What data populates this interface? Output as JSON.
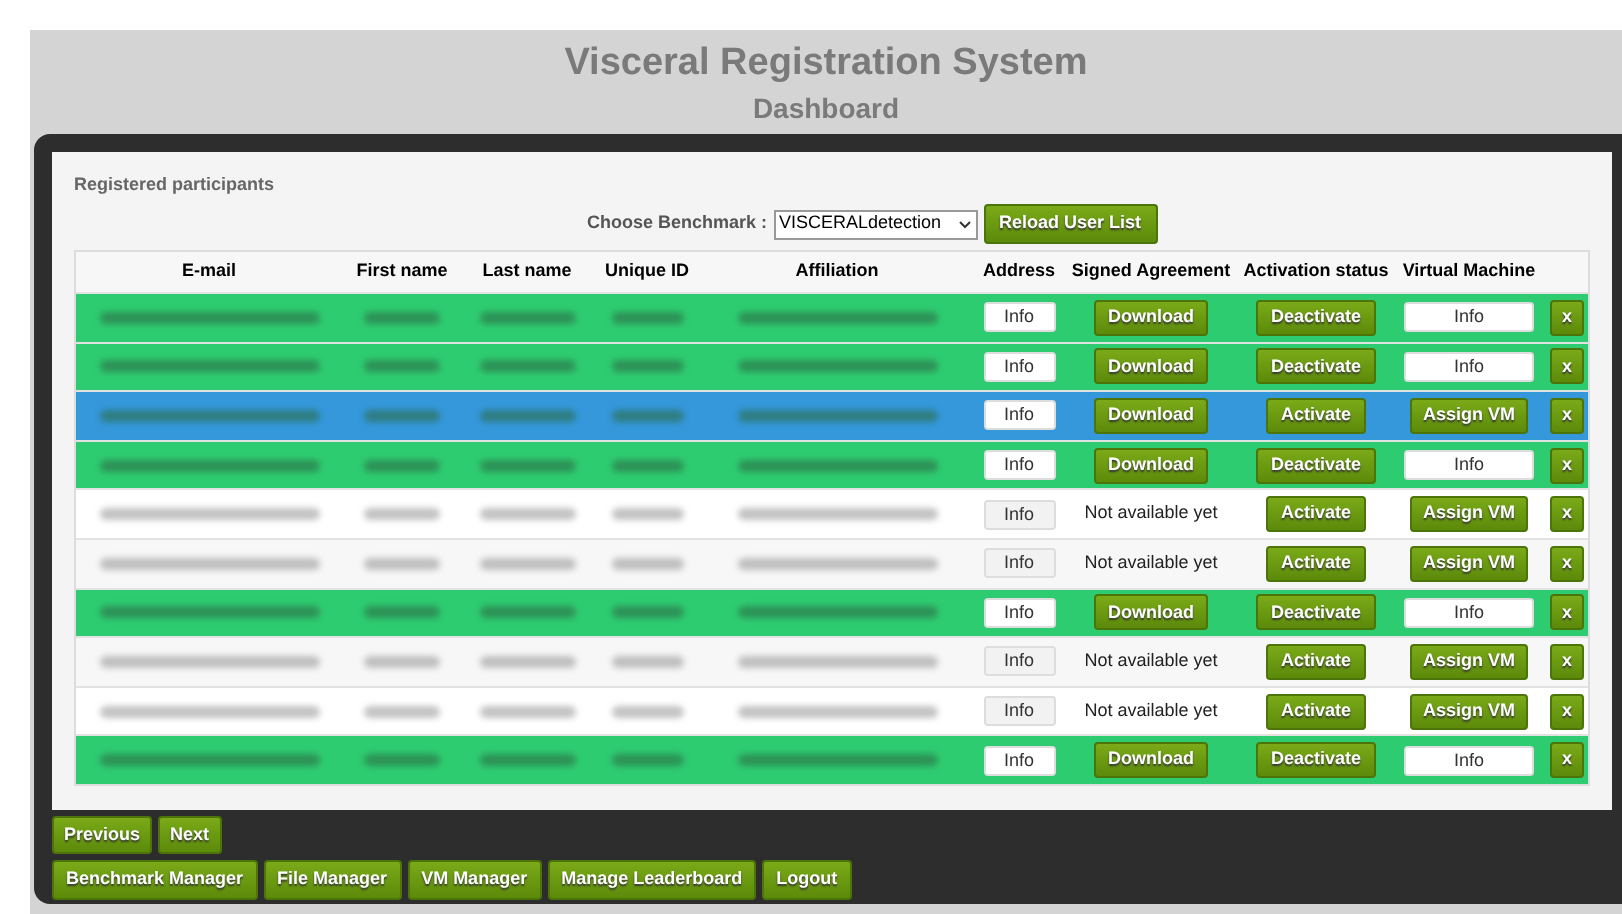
{
  "header": {
    "title": "Visceral Registration System",
    "subtitle": "Dashboard"
  },
  "panel": {
    "title": "Registered participants",
    "benchmark_label": "Choose Benchmark :",
    "benchmark_value": "VISCERALdetection",
    "reload_button": "Reload User List"
  },
  "table": {
    "columns": [
      "E-mail",
      "First name",
      "Last name",
      "Unique ID",
      "Affiliation",
      "Address",
      "Signed Agreement",
      "Activation status",
      "Virtual Machine"
    ],
    "rows": [
      {
        "selected": false,
        "activated": true,
        "address": "Info",
        "agreement": {
          "kind": "button",
          "label": "Download"
        },
        "activation": "Deactivate",
        "vm": {
          "kind": "info",
          "label": "Info"
        },
        "delete": "x"
      },
      {
        "selected": false,
        "activated": true,
        "address": "Info",
        "agreement": {
          "kind": "button",
          "label": "Download"
        },
        "activation": "Deactivate",
        "vm": {
          "kind": "info",
          "label": "Info"
        },
        "delete": "x"
      },
      {
        "selected": true,
        "activated": false,
        "address": "Info",
        "agreement": {
          "kind": "button",
          "label": "Download"
        },
        "activation": "Activate",
        "vm": {
          "kind": "assign",
          "label": "Assign VM"
        },
        "delete": "x"
      },
      {
        "selected": false,
        "activated": true,
        "address": "Info",
        "agreement": {
          "kind": "button",
          "label": "Download"
        },
        "activation": "Deactivate",
        "vm": {
          "kind": "info",
          "label": "Info"
        },
        "delete": "x"
      },
      {
        "selected": false,
        "activated": false,
        "address": "Info",
        "agreement": {
          "kind": "text",
          "label": "Not available yet"
        },
        "activation": "Activate",
        "vm": {
          "kind": "assign",
          "label": "Assign VM"
        },
        "delete": "x"
      },
      {
        "selected": false,
        "activated": false,
        "address": "Info",
        "agreement": {
          "kind": "text",
          "label": "Not available yet"
        },
        "activation": "Activate",
        "vm": {
          "kind": "assign",
          "label": "Assign VM"
        },
        "delete": "x"
      },
      {
        "selected": false,
        "activated": true,
        "address": "Info",
        "agreement": {
          "kind": "button",
          "label": "Download"
        },
        "activation": "Deactivate",
        "vm": {
          "kind": "info",
          "label": "Info"
        },
        "delete": "x"
      },
      {
        "selected": false,
        "activated": false,
        "address": "Info",
        "agreement": {
          "kind": "text",
          "label": "Not available yet"
        },
        "activation": "Activate",
        "vm": {
          "kind": "assign",
          "label": "Assign VM"
        },
        "delete": "x"
      },
      {
        "selected": false,
        "activated": false,
        "address": "Info",
        "agreement": {
          "kind": "text",
          "label": "Not available yet"
        },
        "activation": "Activate",
        "vm": {
          "kind": "assign",
          "label": "Assign VM"
        },
        "delete": "x"
      },
      {
        "selected": false,
        "activated": true,
        "address": "Info",
        "agreement": {
          "kind": "button",
          "label": "Download"
        },
        "activation": "Deactivate",
        "vm": {
          "kind": "info",
          "label": "Info"
        },
        "delete": "x"
      }
    ]
  },
  "pager": [
    "Previous",
    "Next"
  ],
  "nav": [
    "Benchmark Manager",
    "File Manager",
    "VM Manager",
    "Manage Leaderboard",
    "Logout"
  ]
}
